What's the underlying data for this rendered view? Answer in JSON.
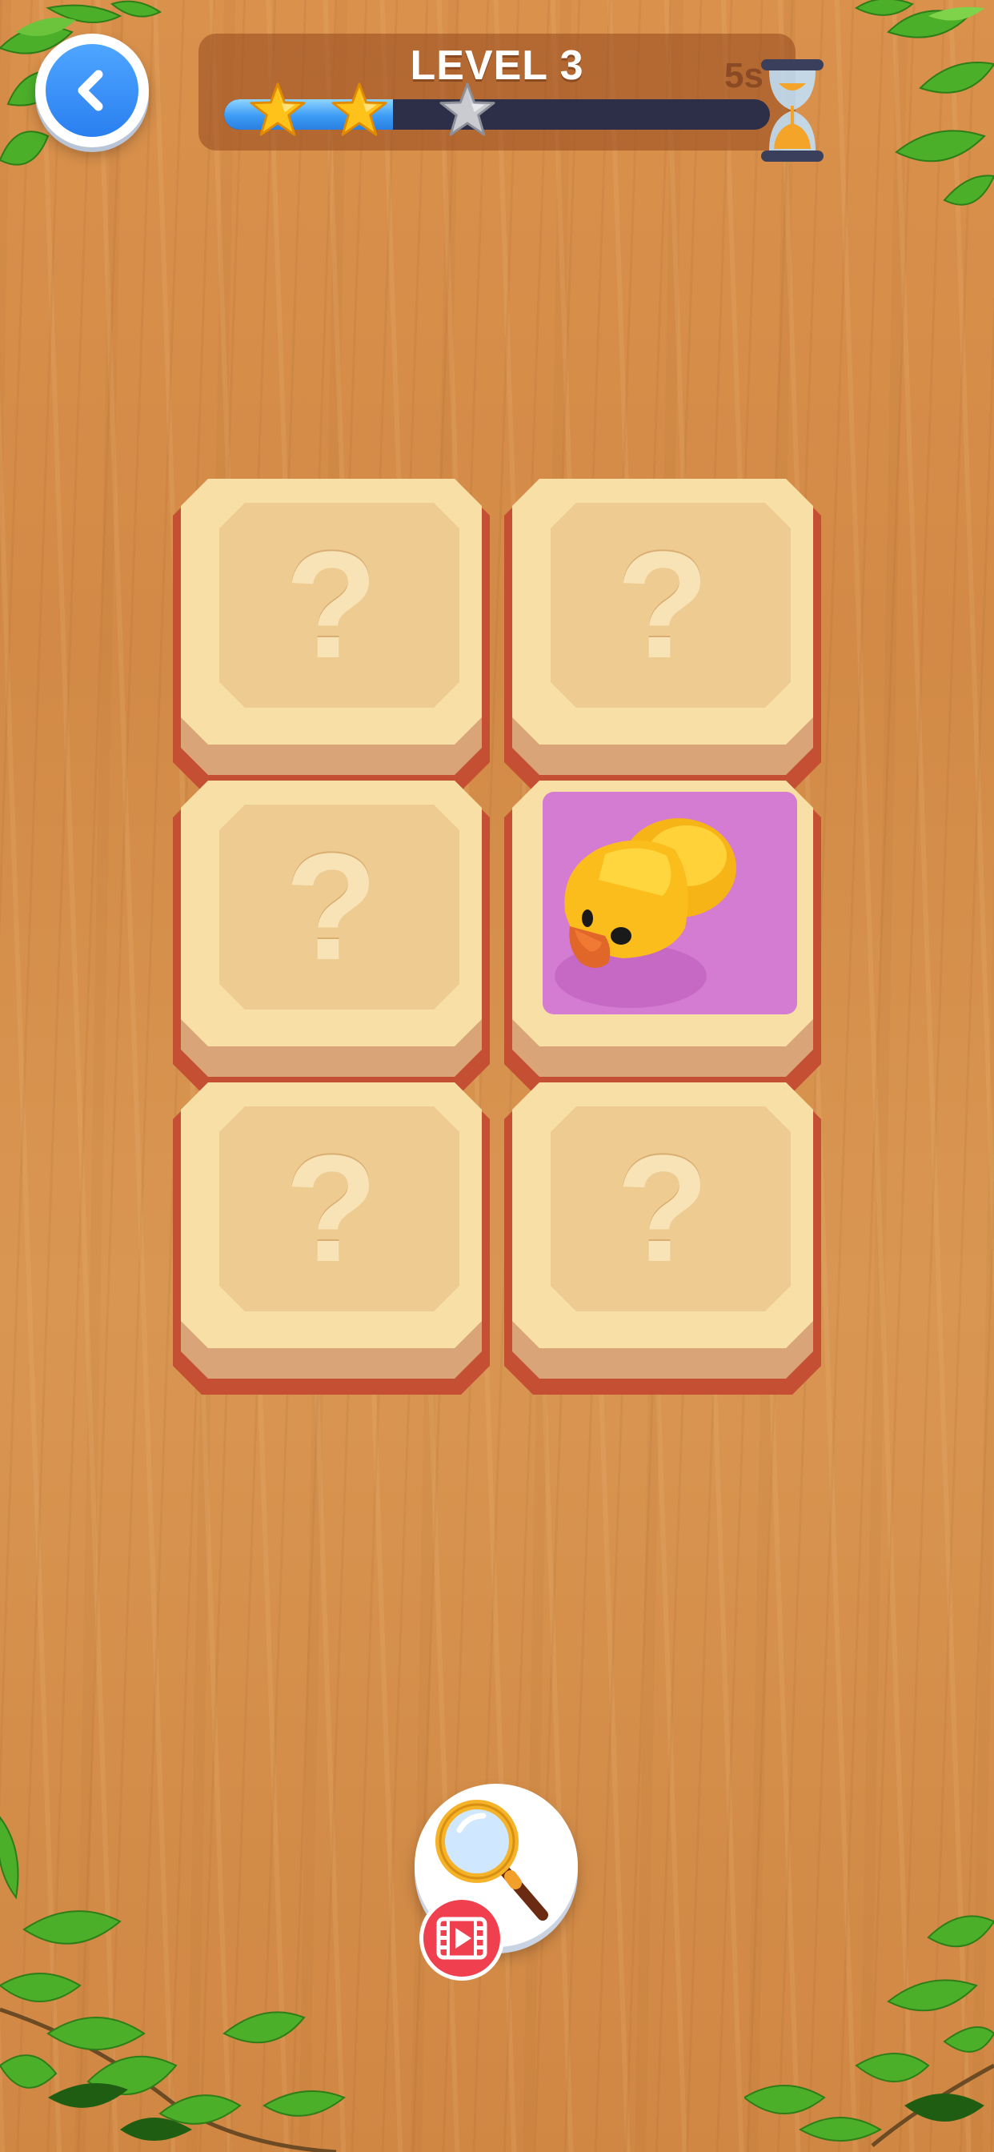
{
  "header": {
    "back_icon": "chevron-left-icon",
    "level_title": "LEVEL 3",
    "timer_text": "5s",
    "timer_icon": "hourglass-icon",
    "progress_fraction": 0.31,
    "stars": [
      {
        "state": "gold"
      },
      {
        "state": "gold"
      },
      {
        "state": "silver"
      }
    ]
  },
  "board": {
    "rows": 3,
    "cols": 2,
    "cards": [
      {
        "state": "hidden",
        "symbol": "?"
      },
      {
        "state": "hidden",
        "symbol": "?"
      },
      {
        "state": "hidden",
        "symbol": "?"
      },
      {
        "state": "revealed",
        "content": "duck",
        "background": "#d47bd2"
      },
      {
        "state": "hidden",
        "symbol": "?"
      },
      {
        "state": "hidden",
        "symbol": "?"
      }
    ]
  },
  "hint": {
    "icon": "magnifier-icon",
    "badge_icon": "video-ad-icon",
    "badge_color": "#f0404f"
  },
  "colors": {
    "accent_blue": "#2a7ff0",
    "card_face": "#f7dfa6",
    "card_base": "#c44f33",
    "star_gold": "#ffc21a"
  }
}
